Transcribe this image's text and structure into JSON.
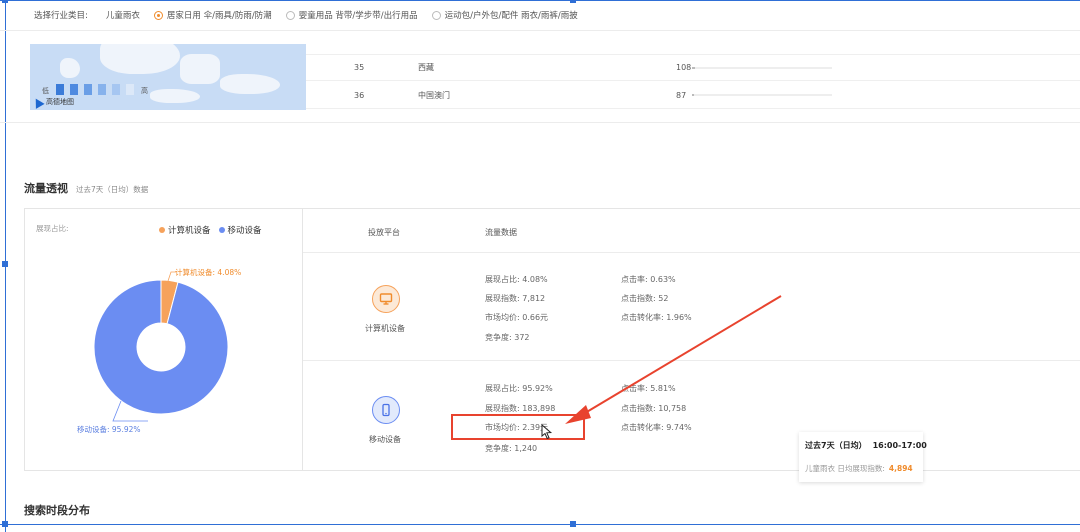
{
  "industry": {
    "label": "选择行业类目:",
    "plain_item": "儿童雨衣",
    "options": [
      {
        "label": "居家日用 伞/雨具/防雨/防潮",
        "selected": true
      },
      {
        "label": "婴童用品 背带/学步带/出行用品",
        "selected": false
      },
      {
        "label": "运动包/户外包/配件 雨衣/雨裤/雨披",
        "selected": false
      }
    ]
  },
  "map": {
    "legend_low": "低",
    "legend_high": "高",
    "attribution": "高德地图"
  },
  "ranking": {
    "rows": [
      {
        "rank": "35",
        "region": "西藏",
        "value": "108",
        "bar_fraction": 0.02
      },
      {
        "rank": "36",
        "region": "中国澳门",
        "value": "87",
        "bar_fraction": 0.015
      }
    ]
  },
  "traffic": {
    "title": "流量透视",
    "subtitle": "过去7天（日均）数据",
    "share_label": "展现占比:",
    "legend": [
      {
        "name": "计算机设备",
        "color": "#f6a25b"
      },
      {
        "name": "移动设备",
        "color": "#6b8df2"
      }
    ],
    "pie_labels": {
      "pc": "计算机设备: 4.08%",
      "mobile": "移动设备: 95.92%"
    },
    "columns": {
      "platform": "投放平台",
      "data": "流量数据"
    },
    "devices": [
      {
        "name": "计算机设备",
        "icon": "monitor-icon",
        "metrics_left": [
          "展现占比: 4.08%",
          "展现指数: 7,812",
          "市场均价: 0.66元",
          "竞争度: 372"
        ],
        "metrics_right": [
          "点击率: 0.63%",
          "点击指数: 52",
          "点击转化率: 1.96%"
        ]
      },
      {
        "name": "移动设备",
        "icon": "phone-icon",
        "metrics_left": [
          "展现占比: 95.92%",
          "展现指数: 183,898",
          "市场均价: 2.39元",
          "竞争度: 1,240"
        ],
        "metrics_right": [
          "点击率: 5.81%",
          "点击指数: 10,758",
          "点击转化率: 9.74%"
        ]
      }
    ]
  },
  "chart_data": {
    "type": "pie",
    "categories": [
      "计算机设备",
      "移动设备"
    ],
    "values": [
      4.08,
      95.92
    ],
    "title": "",
    "legend": "top-right",
    "colors": [
      "#f6a25b",
      "#6b8df2"
    ]
  },
  "tooltip": {
    "period": "过去7天（日均）",
    "time": "16:00-17:00",
    "label": "儿童雨衣 日均展现指数:",
    "value": "4,894"
  },
  "search_section": {
    "title": "搜索时段分布"
  }
}
